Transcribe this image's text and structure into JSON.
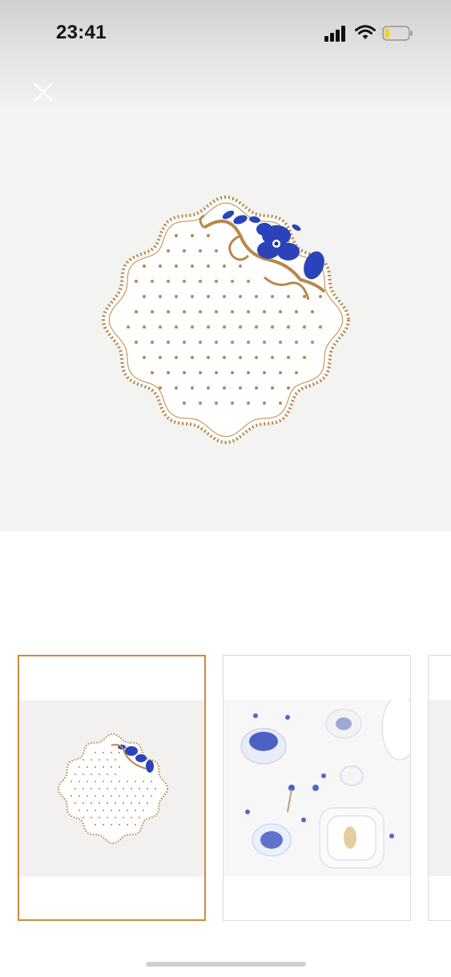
{
  "status_bar": {
    "time": "23:41",
    "icons": [
      "signal-icon",
      "wifi-icon",
      "battery-icon"
    ],
    "battery_level": 0.2,
    "battery_color": "#f5d21c"
  },
  "toolbar": {
    "close_icon": "close-icon"
  },
  "gallery": {
    "selected_index": 0,
    "accent_color": "#d08a3c",
    "thumbnails": [
      {
        "name": "plate-polka-dot-floral"
      },
      {
        "name": "table-setting-blue-floral"
      },
      {
        "name": "partial-next-image"
      }
    ]
  },
  "colors": {
    "hero_background": "#f3f3f2",
    "gold": "#b9874a",
    "blue": "#2a43b8"
  }
}
